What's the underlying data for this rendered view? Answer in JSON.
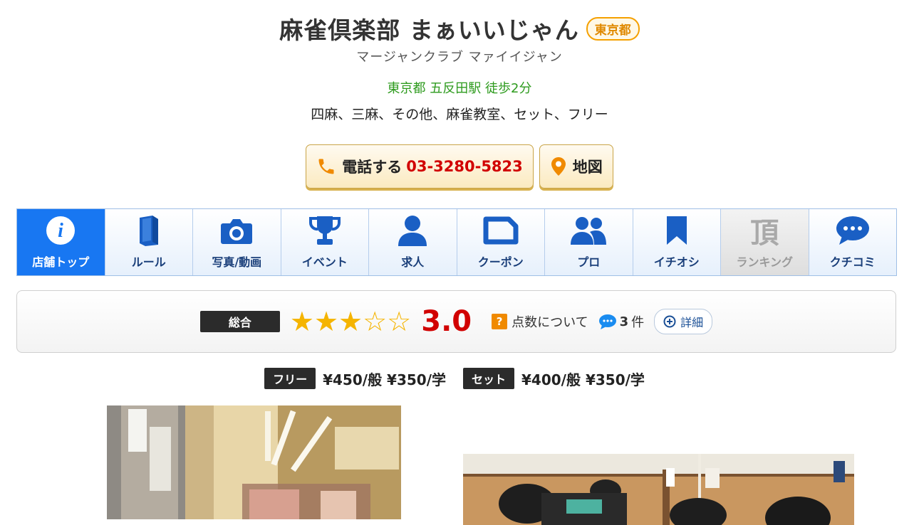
{
  "store": {
    "name": "麻雀倶楽部 まぁいいじゃん",
    "prefecture_badge": "東京都",
    "kana": "マージャンクラブ マァイイジャン",
    "access": "東京都 五反田駅 徒歩2分",
    "genres": "四麻、三麻、その他、麻雀教室、セット、フリー"
  },
  "actions": {
    "call_label": "電話する",
    "phone": "03-3280-5823",
    "map_label": "地図"
  },
  "tabs": [
    {
      "label": "店舗トップ",
      "icon": "info-icon",
      "state": "active"
    },
    {
      "label": "ルール",
      "icon": "book-icon",
      "state": "normal"
    },
    {
      "label": "写真/動画",
      "icon": "camera-icon",
      "state": "normal"
    },
    {
      "label": "イベント",
      "icon": "trophy-icon",
      "state": "normal"
    },
    {
      "label": "求人",
      "icon": "person-icon",
      "state": "normal"
    },
    {
      "label": "クーポン",
      "icon": "coupon-icon",
      "state": "normal"
    },
    {
      "label": "プロ",
      "icon": "people-icon",
      "state": "normal"
    },
    {
      "label": "イチオシ",
      "icon": "bookmark-icon",
      "state": "normal"
    },
    {
      "label": "ランキング",
      "icon": "rank-kanji-icon",
      "kanji": "頂",
      "state": "disabled"
    },
    {
      "label": "クチコミ",
      "icon": "speech-bubble-icon",
      "state": "normal"
    }
  ],
  "rating": {
    "label": "総合",
    "stars_filled": 3,
    "stars_total": 5,
    "score": "3.0",
    "about_label": "点数について",
    "qmark": "?",
    "review_count": "3",
    "review_unit": "件",
    "detail_label": "詳細"
  },
  "prices": [
    {
      "tag": "フリー",
      "value": "¥450/般 ¥350/学"
    },
    {
      "tag": "セット",
      "value": "¥400/般 ¥350/学"
    }
  ],
  "colors": {
    "accent_blue": "#1877f2",
    "price_red": "#d10000",
    "access_green": "#2e9b1e",
    "star_gold": "#f5b400"
  }
}
